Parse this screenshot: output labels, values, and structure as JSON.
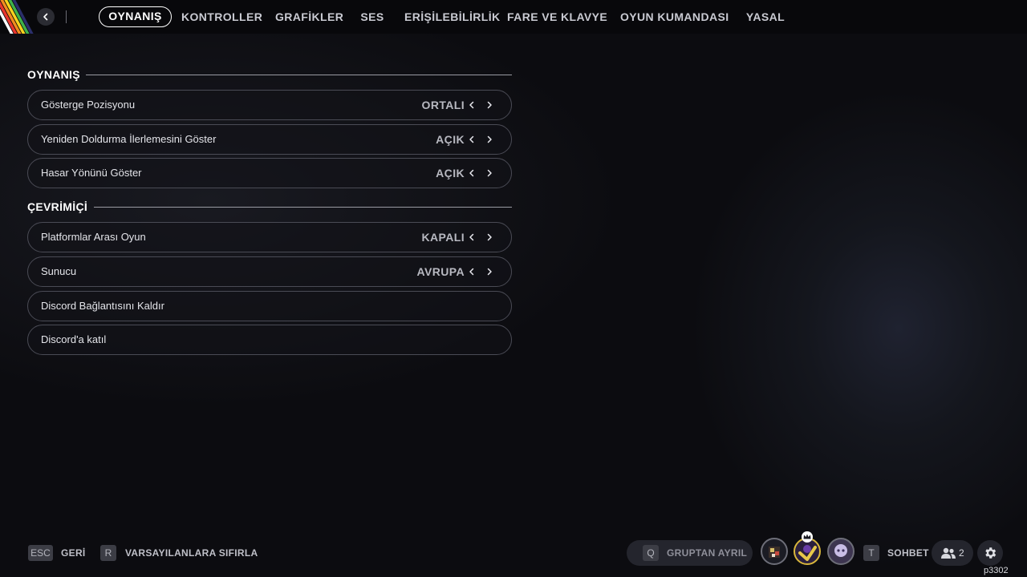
{
  "tabs": [
    {
      "label": "OYNANIŞ",
      "active": true
    },
    {
      "label": "KONTROLLER"
    },
    {
      "label": "GRAFİKLER"
    },
    {
      "label": "SES"
    },
    {
      "label": "ERİŞİLEBİLİRLİK"
    },
    {
      "label": "FARE VE KLAVYE"
    },
    {
      "label": "OYUN KUMANDASI"
    },
    {
      "label": "YASAL"
    }
  ],
  "sections": {
    "gameplay": {
      "title": "OYNANIŞ",
      "rows": [
        {
          "label": "Gösterge Pozisyonu",
          "value": "ORTALI"
        },
        {
          "label": "Yeniden Doldurma İlerlemesini Göster",
          "value": "AÇIK"
        },
        {
          "label": "Hasar Yönünü Göster",
          "value": "AÇIK"
        }
      ]
    },
    "online": {
      "title": "ÇEVRİMİÇİ",
      "rows": [
        {
          "label": "Platformlar Arası Oyun",
          "value": "KAPALI"
        },
        {
          "label": "Sunucu",
          "value": "AVRUPA"
        },
        {
          "label": "Discord Bağlantısını Kaldır"
        },
        {
          "label": "Discord'a katıl"
        }
      ]
    }
  },
  "footer": {
    "back_key": "ESC",
    "back_label": "GERİ",
    "reset_key": "R",
    "reset_label": "VARSAYILANLARA SIFIRLA",
    "leave_key": "Q",
    "leave_label": "GRUPTAN AYRIL",
    "chat_key": "T",
    "chat_label": "SOHBET",
    "friends_count": "2"
  },
  "version": "p3302",
  "icons": {
    "back": "chevron-left-icon",
    "friends": "friends-icon",
    "settings": "gear-icon",
    "crown": "crown-icon"
  },
  "colors": {
    "background": "#0c0c10",
    "row_border": "#4a4b55",
    "accent_white": "#ffffff"
  }
}
